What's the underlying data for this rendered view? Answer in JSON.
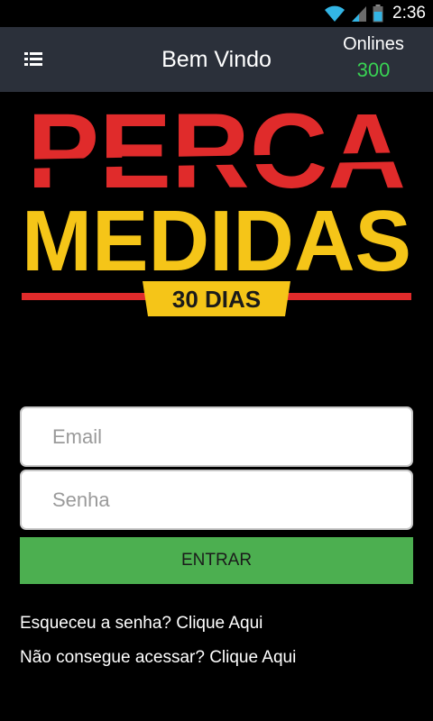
{
  "status_bar": {
    "time": "2:36",
    "icons": [
      "wifi-icon",
      "signal-icon",
      "battery-icon"
    ]
  },
  "app_bar": {
    "menu_icon": "list-icon",
    "title": "Bem Vindo",
    "onlines_label": "Onlines",
    "onlines_count": "300"
  },
  "logo": {
    "line1": "PERCA",
    "line2": "MEDIDAS",
    "badge": "30 DIAS",
    "colors": {
      "red": "#e02b2b",
      "yellow": "#f5c518"
    }
  },
  "form": {
    "email_placeholder": "Email",
    "password_placeholder": "Senha",
    "submit_label": "ENTRAR"
  },
  "links": {
    "forgot": "Esqueceu a senha? Clique Aqui",
    "cant_access": "Não consegue acessar? Clique Aqui"
  },
  "colors": {
    "app_bar": "#2b303a",
    "onlines_count": "#39d353",
    "button": "#4caf50",
    "status_icons": "#33b5e5"
  }
}
